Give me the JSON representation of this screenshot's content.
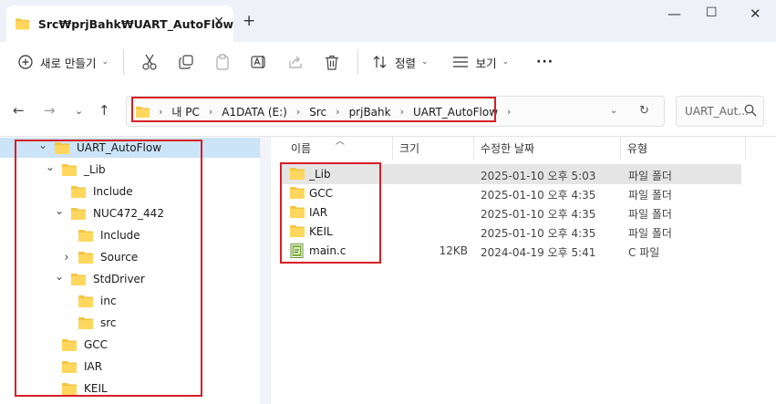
{
  "window": {
    "tab_title": "Src₩prjBahk₩UART_AutoFlow",
    "close_glyph": "✕",
    "new_tab_glyph": "+",
    "minimize_glyph": "—",
    "maximize_glyph": "☐",
    "close_window_glyph": "✕"
  },
  "toolbar": {
    "new_label": "새로 만들기",
    "sort_label": "정렬",
    "view_label": "보기",
    "more_glyph": "···"
  },
  "address": {
    "crumbs": [
      "내 PC",
      "A1DATA (E:)",
      "Src",
      "prjBahk",
      "UART_AutoFlow"
    ],
    "search_placeholder": "UART_Aut..."
  },
  "tree": {
    "items": [
      {
        "label": "UART_AutoFlow",
        "depth": 0,
        "expanded": "open",
        "selected": true
      },
      {
        "label": "_Lib",
        "depth": 1,
        "expanded": "open"
      },
      {
        "label": "Include",
        "depth": 2,
        "expanded": "none"
      },
      {
        "label": "NUC472_442",
        "depth": 2,
        "expanded": "open"
      },
      {
        "label": "Include",
        "depth": 3,
        "expanded": "none"
      },
      {
        "label": "Source",
        "depth": 3,
        "expanded": "closed"
      },
      {
        "label": "StdDriver",
        "depth": 2,
        "expanded": "open"
      },
      {
        "label": "inc",
        "depth": 3,
        "expanded": "none"
      },
      {
        "label": "src",
        "depth": 3,
        "expanded": "none"
      },
      {
        "label": "GCC",
        "depth": 1,
        "expanded": "none"
      },
      {
        "label": "IAR",
        "depth": 1,
        "expanded": "none"
      },
      {
        "label": "KEIL",
        "depth": 1,
        "expanded": "none"
      }
    ]
  },
  "list": {
    "columns": {
      "name": "이름",
      "size": "크기",
      "date": "수정한 날짜",
      "type": "유형"
    },
    "rows": [
      {
        "name": "_Lib",
        "size": "",
        "date": "2025-01-10 오후 5:03",
        "type": "파일 폴더",
        "kind": "folder"
      },
      {
        "name": "GCC",
        "size": "",
        "date": "2025-01-10 오후 4:35",
        "type": "파일 폴더",
        "kind": "folder"
      },
      {
        "name": "IAR",
        "size": "",
        "date": "2025-01-10 오후 4:35",
        "type": "파일 폴더",
        "kind": "folder"
      },
      {
        "name": "KEIL",
        "size": "",
        "date": "2025-01-10 오후 4:35",
        "type": "파일 폴더",
        "kind": "folder"
      },
      {
        "name": "main.c",
        "size": "12KB",
        "date": "2024-04-19 오후 5:41",
        "type": "C 파일",
        "kind": "cfile"
      }
    ]
  },
  "colors": {
    "accent": "#d61f26",
    "folder": "#f4c542",
    "selection": "#cce4f7"
  }
}
